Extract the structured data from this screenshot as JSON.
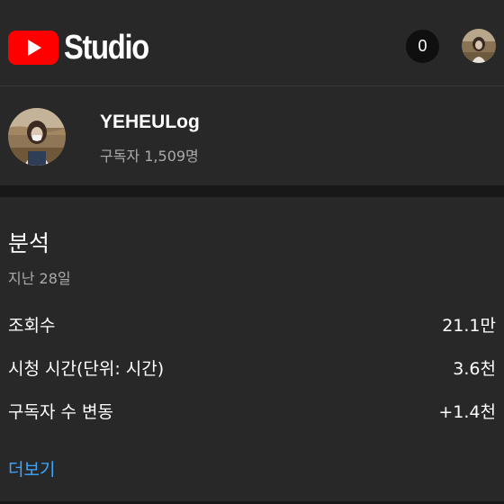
{
  "header": {
    "logo_text": "Studio",
    "notification_count": "0",
    "brand_color": "#ff0000"
  },
  "channel": {
    "name": "YEHEULog",
    "subscribers": "구독자 1,509명"
  },
  "analytics": {
    "title": "분석",
    "period": "지난 28일",
    "metrics": [
      {
        "label": "조회수",
        "value": "21.1만"
      },
      {
        "label": "시청 시간(단위: 시간)",
        "value": "3.6천"
      },
      {
        "label": "구독자 수 변동",
        "value": "+1.4천"
      }
    ],
    "more_label": "더보기",
    "link_color": "#3ea6ff"
  }
}
